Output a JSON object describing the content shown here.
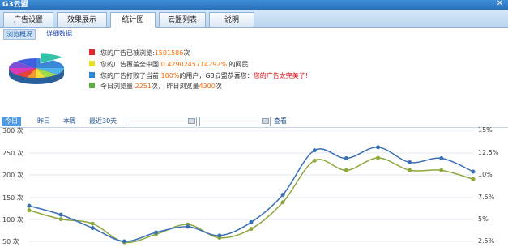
{
  "app": {
    "title": "G3云盟",
    "close_glyph": "✕"
  },
  "tabs": [
    {
      "label": "广告设置",
      "active": false
    },
    {
      "label": "效果展示",
      "active": false
    },
    {
      "label": "统计图",
      "active": true
    },
    {
      "label": "云盟列表",
      "active": false
    },
    {
      "label": "说明",
      "active": false
    }
  ],
  "subtabs": {
    "overview": "浏览概况",
    "details": "详细数据"
  },
  "stats": {
    "line1": {
      "pre": "您的广告已被浏览:",
      "value": "1501586",
      "post": "次",
      "color": "#e52525"
    },
    "line2": {
      "pre": "您的广告覆盖全中国:",
      "value": "0.4290245714292%",
      "post": " 的网民",
      "color": "#e6e020"
    },
    "line3": {
      "pre": "您的广告打败了当前 ",
      "value": "100%",
      "post": "的用户，G3云盟恭喜您：",
      "post2": "您的广告太完美了!",
      "color": "#2a86d8"
    },
    "line4": {
      "pre": "今日浏览量 ",
      "value": "2251",
      "post": "次，  昨日浏览量",
      "value2": "4300",
      "post2": "次",
      "color": "#59b040"
    }
  },
  "pie_colors": [
    "#3b86d6",
    "#4fb5e8",
    "#a0d84a",
    "#f2e238",
    "#f39a2e",
    "#e8403a",
    "#d93bb0",
    "#7c4fd8",
    "#3f5fe0",
    "#32c2a8"
  ],
  "toolbar": {
    "today": "今日",
    "yesterday": "昨日",
    "week": "本周",
    "last30": "最近30天",
    "date_from": "",
    "date_to": "",
    "view": "查看"
  },
  "chart_data": {
    "type": "line",
    "y_left": {
      "ticks": [
        "300 次",
        "250 次",
        "200 次",
        "150 次",
        "100 次",
        "50 次"
      ],
      "range": [
        50,
        300
      ]
    },
    "y_right": {
      "ticks": [
        "15%",
        "12.5%",
        "10%",
        "7.5%",
        "5%",
        "2.5%"
      ],
      "range": [
        2.5,
        15
      ]
    },
    "series": [
      {
        "axis": "left",
        "color": "#3a6fb5",
        "values": [
          130,
          110,
          80,
          50,
          70,
          83,
          63,
          93,
          155,
          255,
          237,
          262,
          228,
          237,
          207
        ]
      },
      {
        "axis": "right",
        "color": "#8ba83a",
        "values": [
          6.0,
          5.0,
          4.5,
          2.4,
          3.3,
          4.4,
          2.9,
          3.9,
          6.9,
          11.6,
          10.5,
          11.9,
          10.5,
          10.5,
          9.5
        ]
      }
    ]
  }
}
